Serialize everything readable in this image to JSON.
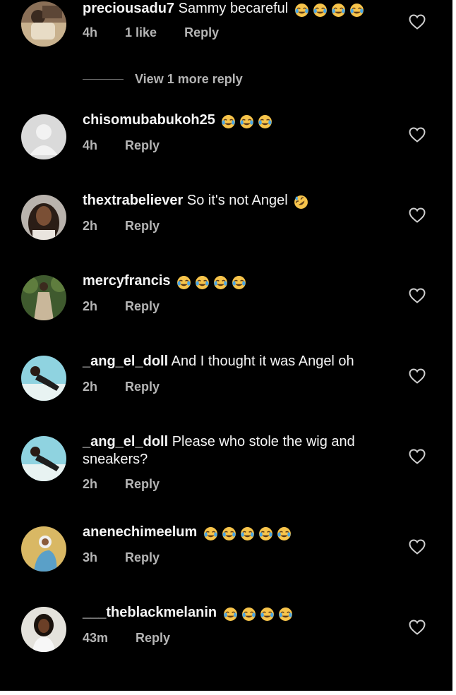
{
  "comments": [
    {
      "username": "preciousadu7",
      "text": "Sammy becareful",
      "emoji": "😂😂😂😂",
      "time": "4h",
      "likes": "1 like",
      "reply": "Reply"
    },
    {
      "username": "chisomubabukoh25",
      "text": "",
      "emoji": "😂😂😂",
      "time": "4h",
      "reply": "Reply"
    },
    {
      "username": "thextrabeliever",
      "text": "So it's not Angel",
      "emoji": "🤣",
      "time": "2h",
      "reply": "Reply"
    },
    {
      "username": "mercyfrancis",
      "text": "",
      "emoji": "😂😂😂😂",
      "time": "2h",
      "reply": "Reply"
    },
    {
      "username": "_ang_el_doll",
      "text": "And I thought it was Angel oh",
      "emoji": "",
      "time": "2h",
      "reply": "Reply"
    },
    {
      "username": "_ang_el_doll",
      "text": "Please who stole the wig and sneakers?",
      "emoji": "",
      "time": "2h",
      "reply": "Reply"
    },
    {
      "username": "anenechimeelum",
      "text": "",
      "emoji": "😂😂😂😂😂",
      "time": "3h",
      "reply": "Reply"
    },
    {
      "username": "___theblackmelanin",
      "text": "",
      "emoji": "😂😂😂😂",
      "time": "43m",
      "reply": "Reply"
    }
  ],
  "view_more": {
    "label": "View 1 more reply"
  },
  "partial_row": {
    "username": "",
    "emoji_count": 5
  },
  "icons": {
    "like": "heart-outline-icon",
    "emoji_laugh": "face-with-tears-of-joy-icon",
    "emoji_rofl": "rolling-on-floor-laughing-icon",
    "default_avatar": "default-avatar-icon"
  },
  "colors": {
    "background": "#000000",
    "primary_text": "#f5f5f5",
    "secondary_text": "#b5b5b5",
    "emoji_yellow": "#f7c44b",
    "emoji_tear": "#4aa7e8"
  }
}
